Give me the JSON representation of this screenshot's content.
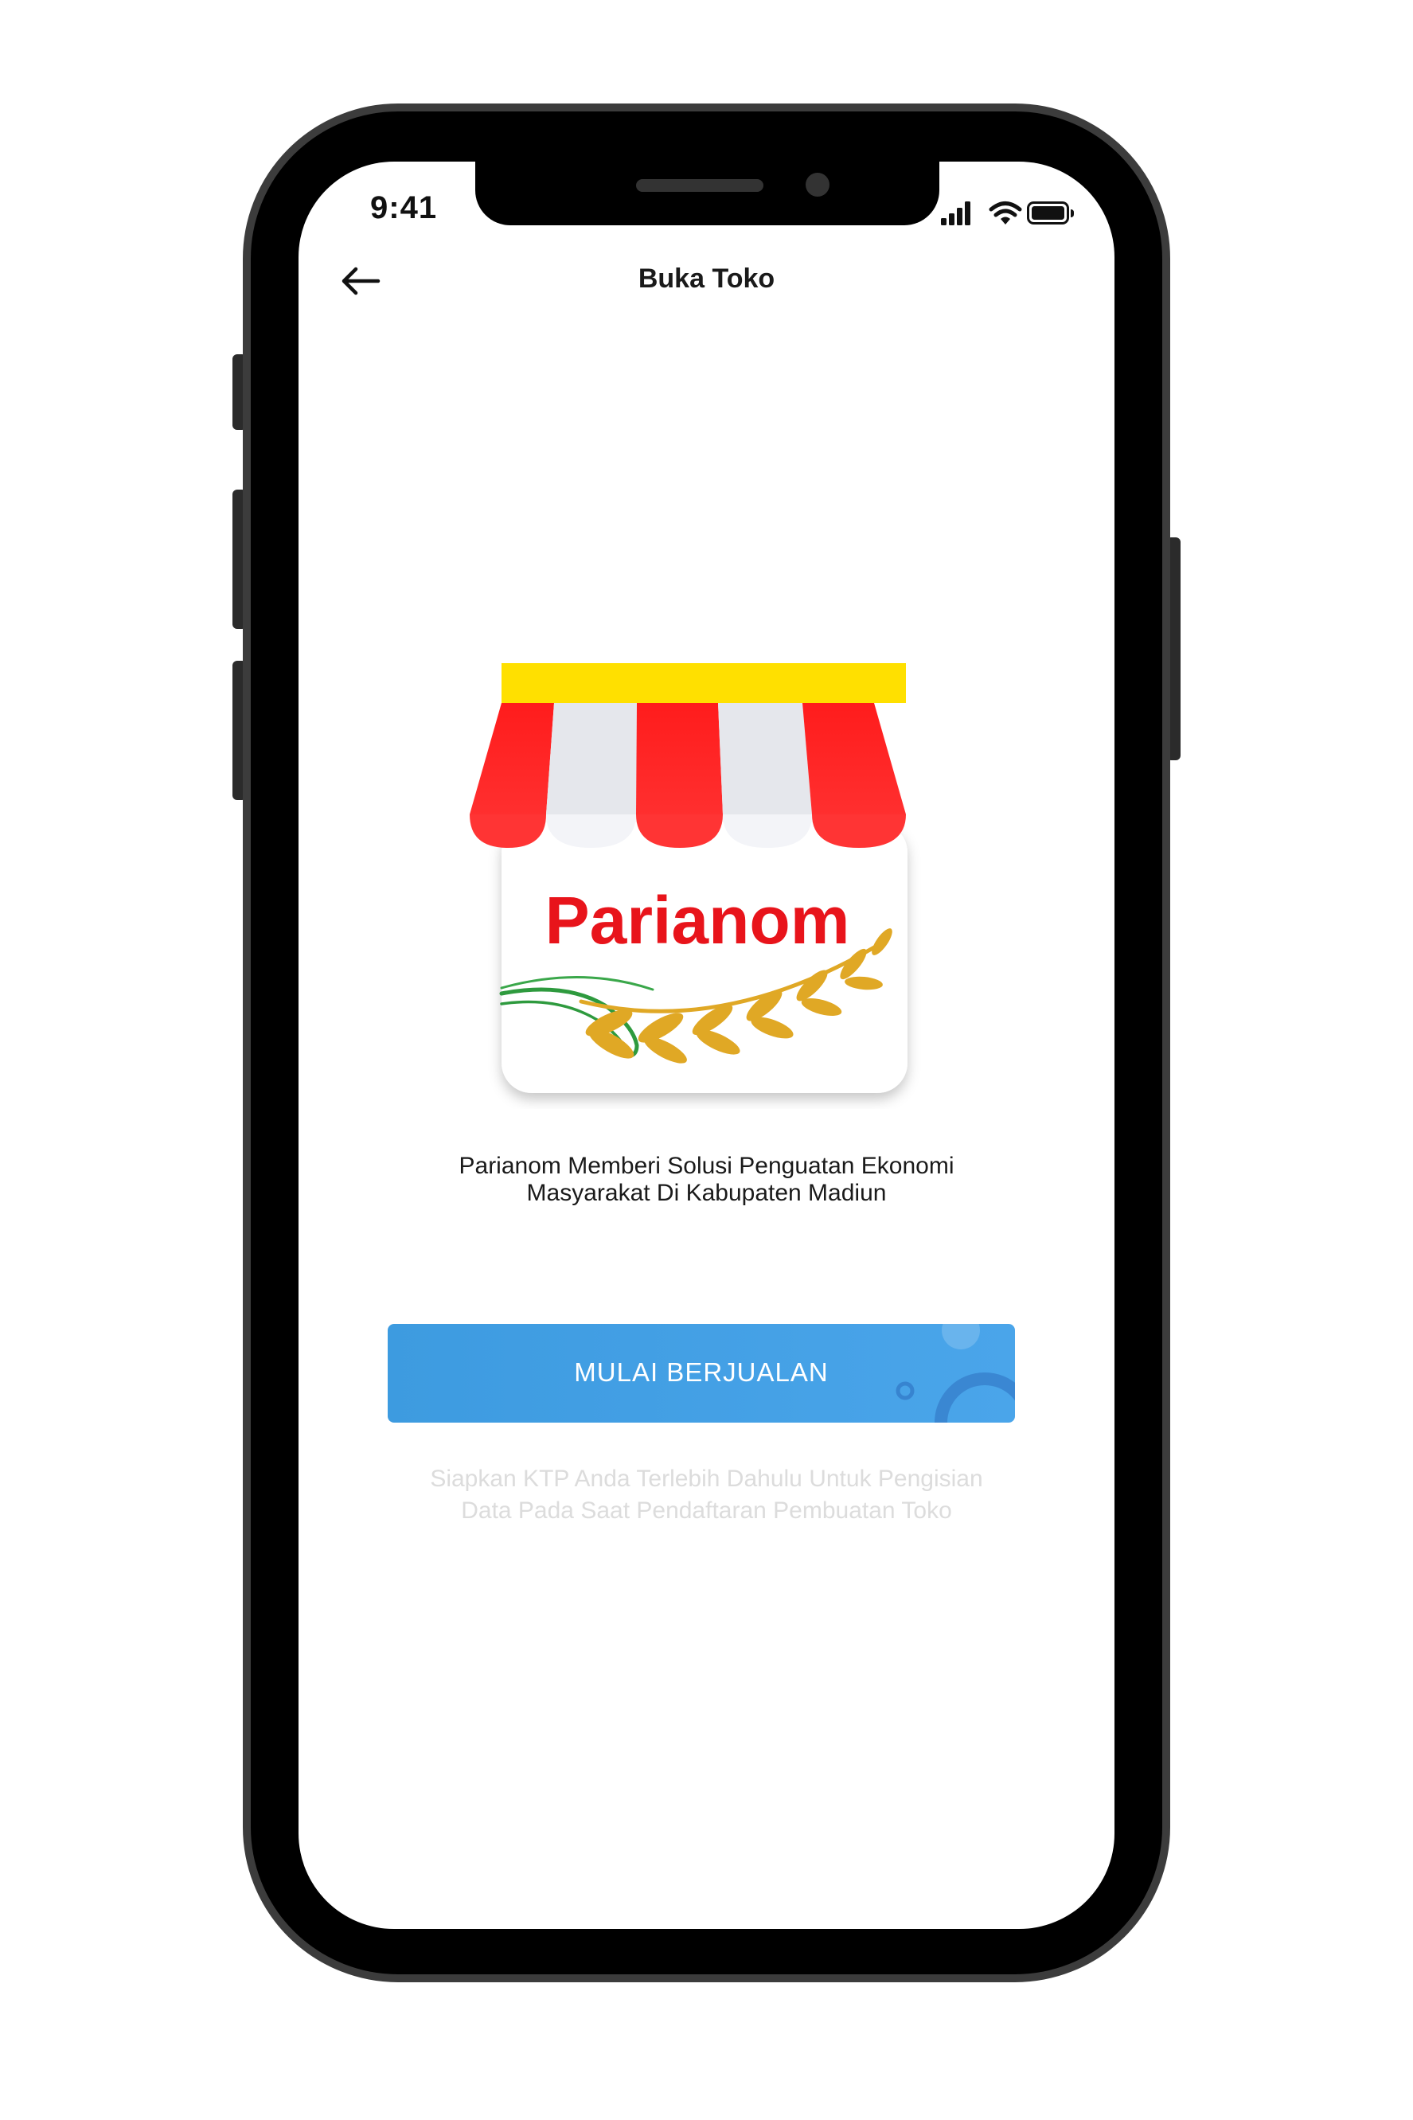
{
  "status_bar": {
    "time": "9:41",
    "signal_icon": "cellular-signal-icon",
    "wifi_icon": "wifi-icon",
    "battery_icon": "battery-icon"
  },
  "header": {
    "back_icon": "arrow-left-icon",
    "title": "Buka Toko"
  },
  "logo": {
    "brand_text": "Parianom",
    "icon": "storefront-awning-icon"
  },
  "main": {
    "tagline_line1": "Parianom Memberi Solusi Penguatan Ekonomi",
    "tagline_line2": "Masyarakat Di Kabupaten Madiun",
    "cta_label": "MULAI BERJUALAN",
    "hint_line1": "Siapkan KTP Anda Terlebih Dahulu Untuk Pengisian",
    "hint_line2": "Data Pada Saat Pendaftaran Pembuatan Toko"
  },
  "colors": {
    "accent_blue": "#3d9be0",
    "awning_red": "#ff1f1f",
    "awning_yellow": "#ffe000",
    "brand_red": "#e8141b",
    "wheat_gold": "#e0a825",
    "leaf_green": "#2e9a3e"
  }
}
